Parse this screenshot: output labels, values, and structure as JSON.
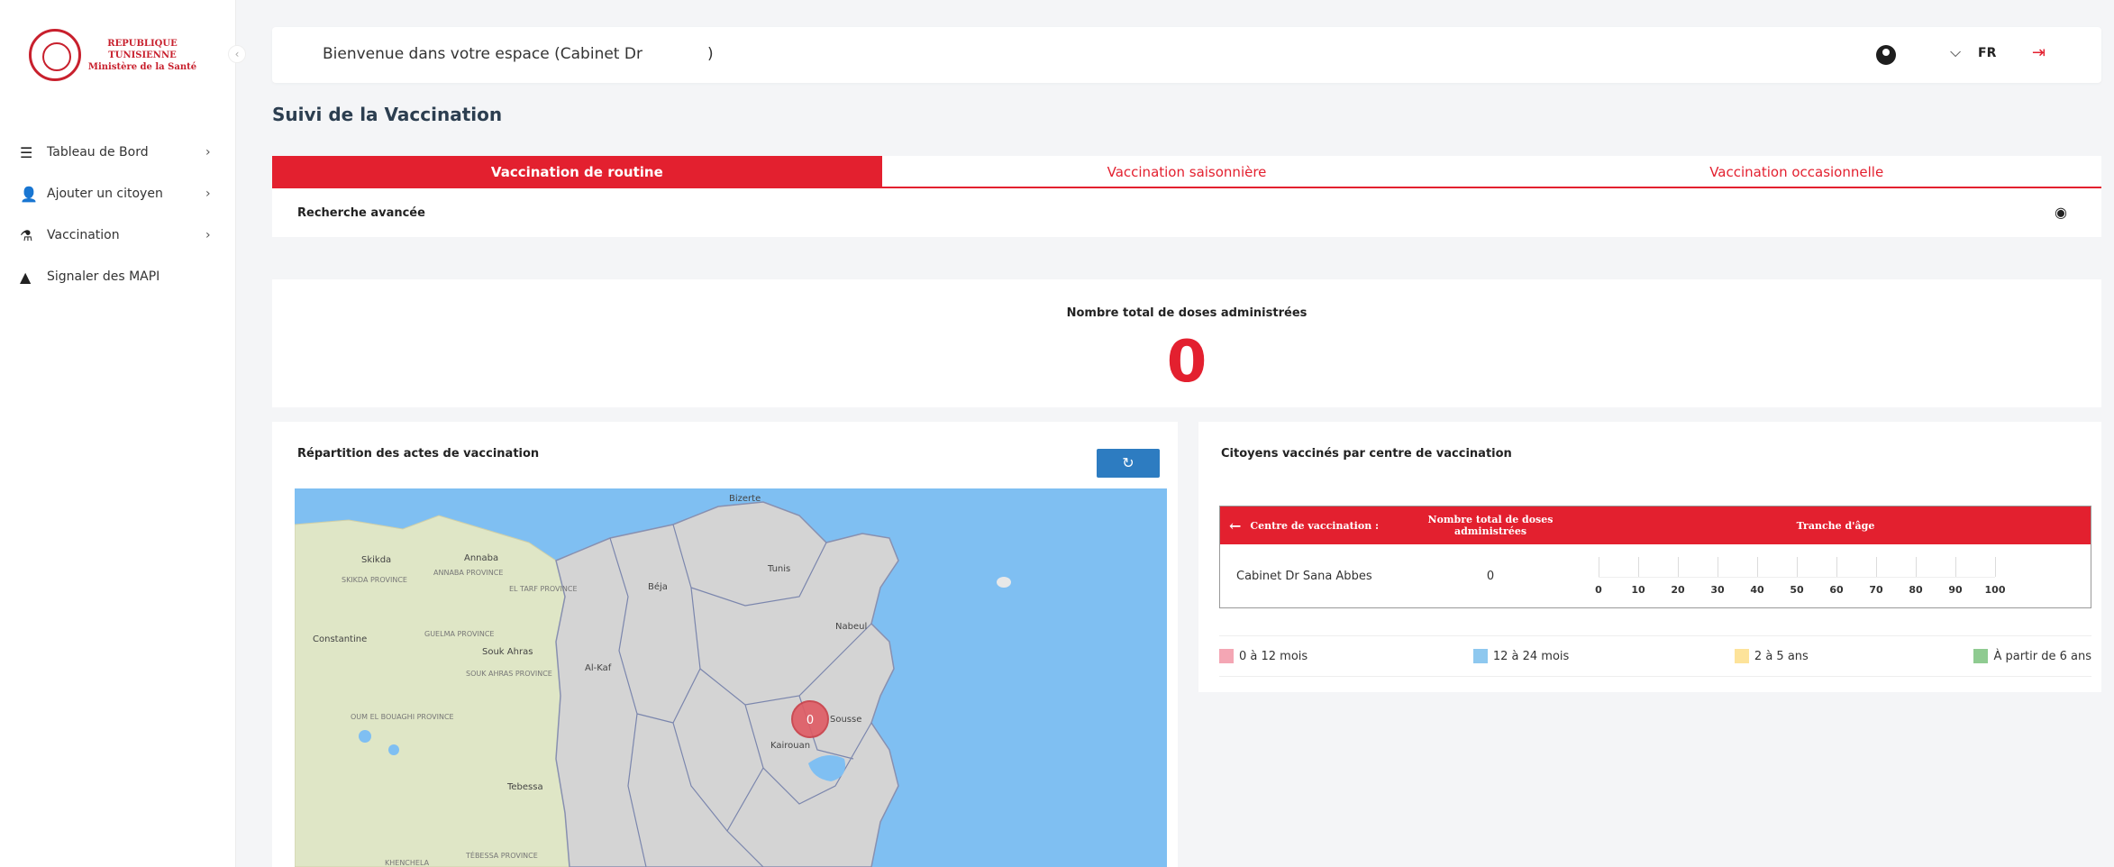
{
  "sidebar": {
    "logo": {
      "line1": "REPUBLIQUE TUNISIENNE",
      "line2": "Ministère de la Santé"
    },
    "items": [
      {
        "label": "Tableau de Bord",
        "icon": "list-icon"
      },
      {
        "label": "Ajouter un citoyen",
        "icon": "user-plus-icon"
      },
      {
        "label": "Vaccination",
        "icon": "vaccine-icon"
      },
      {
        "label": "Signaler des MAPI",
        "icon": "warning-icon"
      }
    ]
  },
  "header": {
    "welcome": "Bienvenue dans votre espace (Cabinet Dr",
    "welcome_close": ")",
    "language": "FR"
  },
  "page": {
    "title": "Suivi de la Vaccination"
  },
  "tabs": [
    {
      "label": "Vaccination de routine",
      "active": true
    },
    {
      "label": "Vaccination saisonnière",
      "active": false
    },
    {
      "label": "Vaccination occasionnelle",
      "active": false
    }
  ],
  "search": {
    "label": "Recherche avancée"
  },
  "total": {
    "label": "Nombre total de doses administrées",
    "value": "0"
  },
  "map_card": {
    "title": "Répartition des actes de vaccination",
    "marker_value": "0",
    "places": [
      "Bizerte",
      "Skikda",
      "Annaba",
      "SKIKDA PROVINCE",
      "ANNABA PROVINCE",
      "EL TARF PROVINCE",
      "Béja",
      "Tunis",
      "Nabeul",
      "Constantine",
      "GUELMA PROVINCE",
      "Souk Ahras",
      "SOUK AHRAS PROVINCE",
      "Al-Kaf",
      "OUM EL BOUAGHI PROVINCE",
      "Sousse",
      "Kairouan",
      "Tebessa",
      "TÉBESSA PROVINCE",
      "KHENCHELA"
    ]
  },
  "table_card": {
    "title": "Citoyens vaccinés par centre de vaccination",
    "headers": [
      "Centre de vaccination :",
      "Nombre total de doses administrées",
      "Tranche d'âge"
    ],
    "rows": [
      {
        "centre": "Cabinet Dr Sana Abbes",
        "doses": "0"
      }
    ],
    "axis_ticks": [
      "0",
      "10",
      "20",
      "30",
      "40",
      "50",
      "60",
      "70",
      "80",
      "90",
      "100"
    ],
    "legend": [
      {
        "label": "0 à 12 mois",
        "color": "#f4a6b4"
      },
      {
        "label": "12 à 24 mois",
        "color": "#8ec8ef"
      },
      {
        "label": "2 à 5 ans",
        "color": "#fde39a"
      },
      {
        "label": "À partir de 6 ans",
        "color": "#8fcb91"
      }
    ]
  },
  "colors": {
    "primary_red": "#e3202f",
    "button_blue": "#2d7cc1",
    "sea": "#7fbff2"
  }
}
